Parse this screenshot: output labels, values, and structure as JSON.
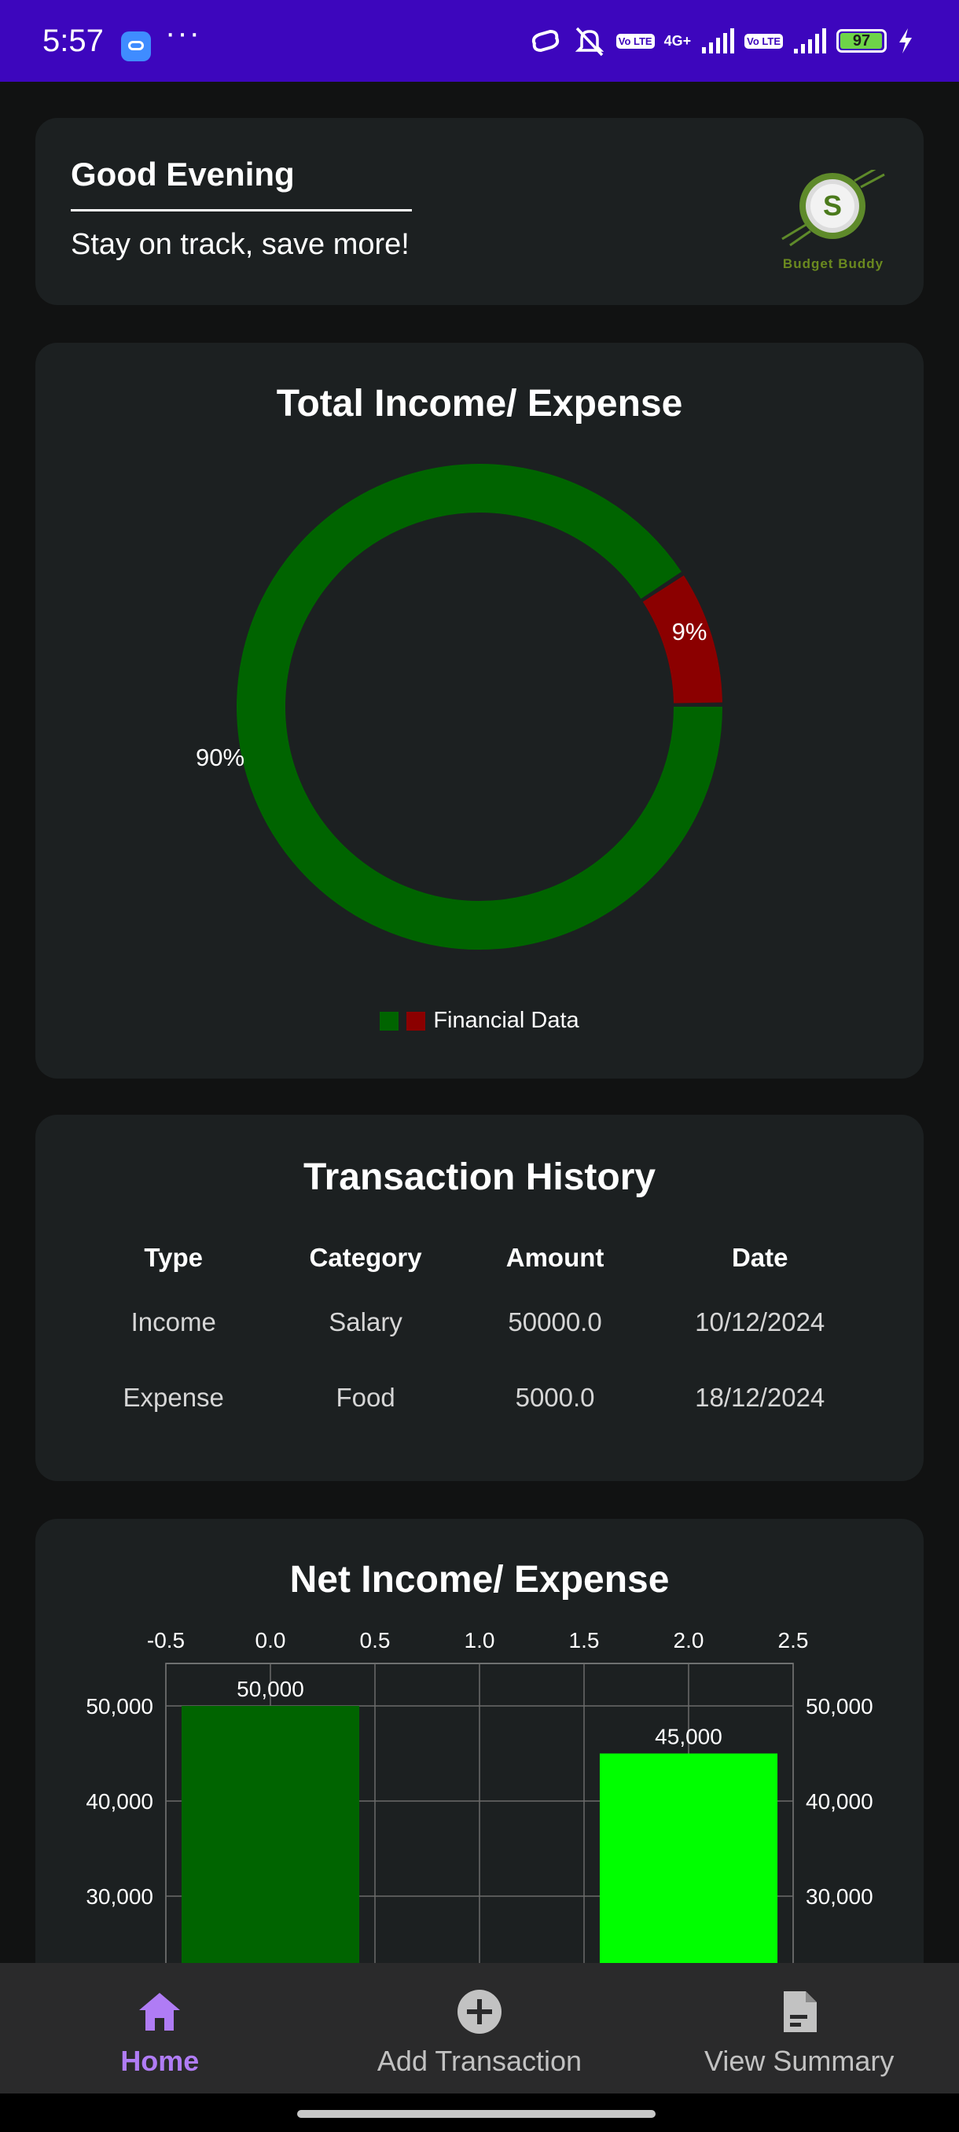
{
  "status_bar": {
    "time": "5:57",
    "dots": "···",
    "volte1": "Vo LTE",
    "network": "4G+",
    "volte2": "Vo LTE",
    "battery": "97",
    "icons": [
      "link-app-icon",
      "link-icon",
      "bell-muted-icon",
      "signal-icon",
      "signal-icon",
      "battery-icon",
      "charging-icon"
    ],
    "color": "#3d06bd"
  },
  "greeting": {
    "title": "Good Evening",
    "subtitle": "Stay on track, save more!",
    "logo_text": "Budget Buddy",
    "logo_letter": "S"
  },
  "pie_card": {
    "title": "Total Income/ Expense",
    "legend_label": "Financial Data"
  },
  "history": {
    "title": "Transaction History",
    "columns": [
      "Type",
      "Category",
      "Amount",
      "Date"
    ],
    "rows": [
      [
        "Income",
        "Salary",
        "50000.0",
        "10/12/2024"
      ],
      [
        "Expense",
        "Food",
        "5000.0",
        "18/12/2024"
      ]
    ]
  },
  "bar_card": {
    "title": "Net Income/ Expense"
  },
  "chart_data": [
    {
      "type": "pie",
      "title": "Total Income/ Expense",
      "series": [
        {
          "name": "Financial Data",
          "values": [
            50000,
            5000
          ]
        }
      ],
      "slice_labels": [
        "90%",
        "9%"
      ],
      "colors": [
        "#006400",
        "#8b0000"
      ],
      "legend": "bottom"
    },
    {
      "type": "bar",
      "title": "Net Income/ Expense",
      "x": [
        0,
        2
      ],
      "values": [
        50000,
        45000
      ],
      "value_labels": [
        "50,000",
        "45,000"
      ],
      "colors": [
        "#006400",
        "#00ff00"
      ],
      "xlim": [
        -0.5,
        2.5
      ],
      "x_ticks": [
        "-0.5",
        "0.0",
        "0.5",
        "1.0",
        "1.5",
        "2.0",
        "2.5"
      ],
      "y_ticks": [
        "50,000",
        "40,000",
        "30,000"
      ],
      "y_tick_values": [
        50000,
        40000,
        30000
      ],
      "grid": true
    }
  ],
  "bottom_nav": {
    "items": [
      {
        "label": "Home",
        "icon": "home-icon",
        "active": true
      },
      {
        "label": "Add Transaction",
        "icon": "add-circle-icon",
        "active": false
      },
      {
        "label": "View Summary",
        "icon": "document-icon",
        "active": false
      }
    ],
    "active_color": "#b07cf5"
  }
}
